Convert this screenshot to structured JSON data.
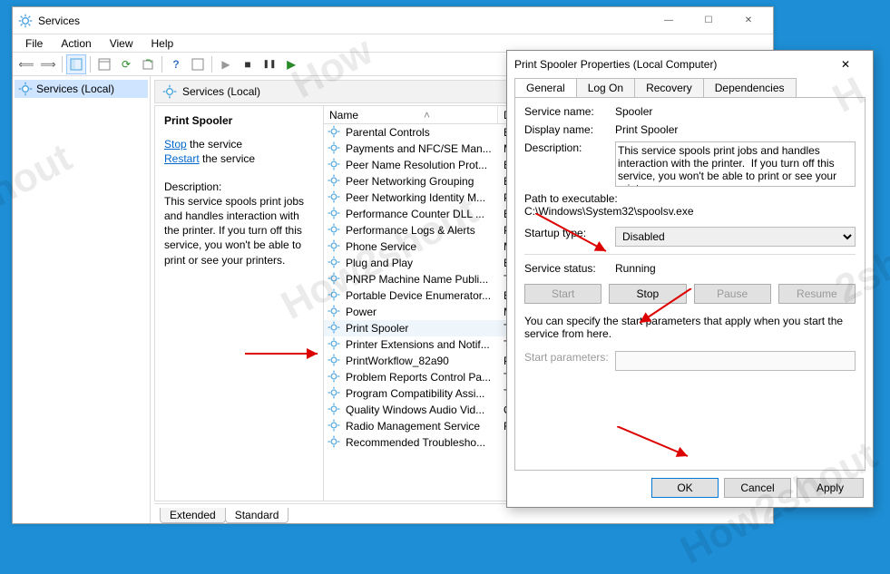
{
  "main_window": {
    "title": "Services",
    "tree_item": "Services (Local)",
    "pane_header": "Services (Local)",
    "menu": {
      "file": "File",
      "action": "Action",
      "view": "View",
      "help": "Help"
    },
    "desc_panel": {
      "service_name": "Print Spooler",
      "stop_link": "Stop",
      "stop_suffix": " the service",
      "restart_link": "Restart",
      "restart_suffix": " the service",
      "description_label": "Description:",
      "description_text": "This service spools print jobs and handles interaction with the printer. If you turn off this service, you won't be able to print or see your printers."
    },
    "columns": {
      "name": "Name",
      "description": "Description"
    },
    "tabs": {
      "extended": "Extended",
      "standard": "Standard"
    },
    "services": [
      {
        "name": "Parental Controls",
        "desc": "Enf"
      },
      {
        "name": "Payments and NFC/SE Man...",
        "desc": "Ma"
      },
      {
        "name": "Peer Name Resolution Prot...",
        "desc": "Ena"
      },
      {
        "name": "Peer Networking Grouping",
        "desc": "Ena"
      },
      {
        "name": "Peer Networking Identity M...",
        "desc": "Pro"
      },
      {
        "name": "Performance Counter DLL ...",
        "desc": "Ena"
      },
      {
        "name": "Performance Logs & Alerts",
        "desc": "Per"
      },
      {
        "name": "Phone Service",
        "desc": "Ma"
      },
      {
        "name": "Plug and Play",
        "desc": "Ena"
      },
      {
        "name": "PNRP Machine Name Publi...",
        "desc": "This"
      },
      {
        "name": "Portable Device Enumerator...",
        "desc": "Enf"
      },
      {
        "name": "Power",
        "desc": "Ma"
      },
      {
        "name": "Print Spooler",
        "desc": "This",
        "selected": true
      },
      {
        "name": "Printer Extensions and Notif...",
        "desc": "This"
      },
      {
        "name": "PrintWorkflow_82a90",
        "desc": "Prin"
      },
      {
        "name": "Problem Reports Control Pa...",
        "desc": "This"
      },
      {
        "name": "Program Compatibility Assi...",
        "desc": "This"
      },
      {
        "name": "Quality Windows Audio Vid...",
        "desc": "Qu"
      },
      {
        "name": "Radio Management Service",
        "desc": "Rad"
      },
      {
        "name": "Recommended Troublesho...",
        "desc": ""
      }
    ]
  },
  "dialog": {
    "title": "Print Spooler Properties (Local Computer)",
    "tabs": {
      "general": "General",
      "logon": "Log On",
      "recovery": "Recovery",
      "dependencies": "Dependencies"
    },
    "labels": {
      "service_name": "Service name:",
      "display_name": "Display name:",
      "description": "Description:",
      "path_label": "Path to executable:",
      "startup_type": "Startup type:",
      "service_status": "Service status:",
      "start_params": "Start parameters:"
    },
    "values": {
      "service_name": "Spooler",
      "display_name": "Print Spooler",
      "description": "This service spools print jobs and handles interaction with the printer.  If you turn off this service, you won't be able to print or see your printers.",
      "path": "C:\\Windows\\System32\\spoolsv.exe",
      "startup_selected": "Disabled",
      "status": "Running"
    },
    "note": "You can specify the start parameters that apply when you start the service from here.",
    "buttons": {
      "start": "Start",
      "stop": "Stop",
      "pause": "Pause",
      "resume": "Resume",
      "ok": "OK",
      "cancel": "Cancel",
      "apply": "Apply"
    }
  },
  "window_controls": {
    "min": "—",
    "max": "☐",
    "close": "✕"
  }
}
